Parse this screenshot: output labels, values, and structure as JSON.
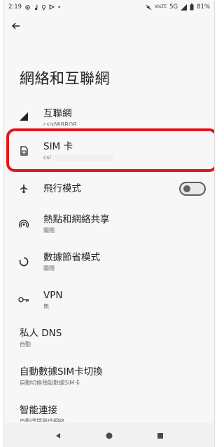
{
  "status_bar": {
    "time": "2:19",
    "network": "5G",
    "battery": "81%"
  },
  "header": {
    "title": "網絡和互聯網"
  },
  "items": [
    {
      "label": "互聯網",
      "sub": "cslxMIRROR"
    },
    {
      "label": "SIM 卡",
      "sub": "csl"
    },
    {
      "label": "飛行模式",
      "toggle": "off"
    },
    {
      "label": "熱點和網絡共享",
      "sub": "關閉"
    },
    {
      "label": "數據節省模式",
      "sub": "關閉"
    },
    {
      "label": "VPN",
      "sub": "無"
    },
    {
      "label": "私人 DNS",
      "sub": "自動"
    },
    {
      "label": "自動數據SIM卡切換",
      "sub": "自動切換預設數據SIM卡"
    },
    {
      "label": "智能連接",
      "sub": "自動選擇最佳網絡"
    }
  ],
  "icons": {
    "status_left": [
      "gear-icon",
      "music-note-icon",
      "location-icon",
      "play-icon"
    ],
    "status_right": [
      "mute-icon",
      "volte-icon",
      "signal-icon",
      "battery-icon"
    ],
    "back": "arrow-left-icon",
    "item_icons": [
      "signal-icon",
      "sim-card-icon",
      "airplane-icon",
      "hotspot-icon",
      "data-saver-icon",
      "vpn-key-icon"
    ],
    "nav": [
      "back-triangle-icon",
      "home-circle-icon",
      "recents-square-icon"
    ]
  },
  "colors": {
    "highlight": "#e5161b",
    "background": "#f7f7f7"
  }
}
